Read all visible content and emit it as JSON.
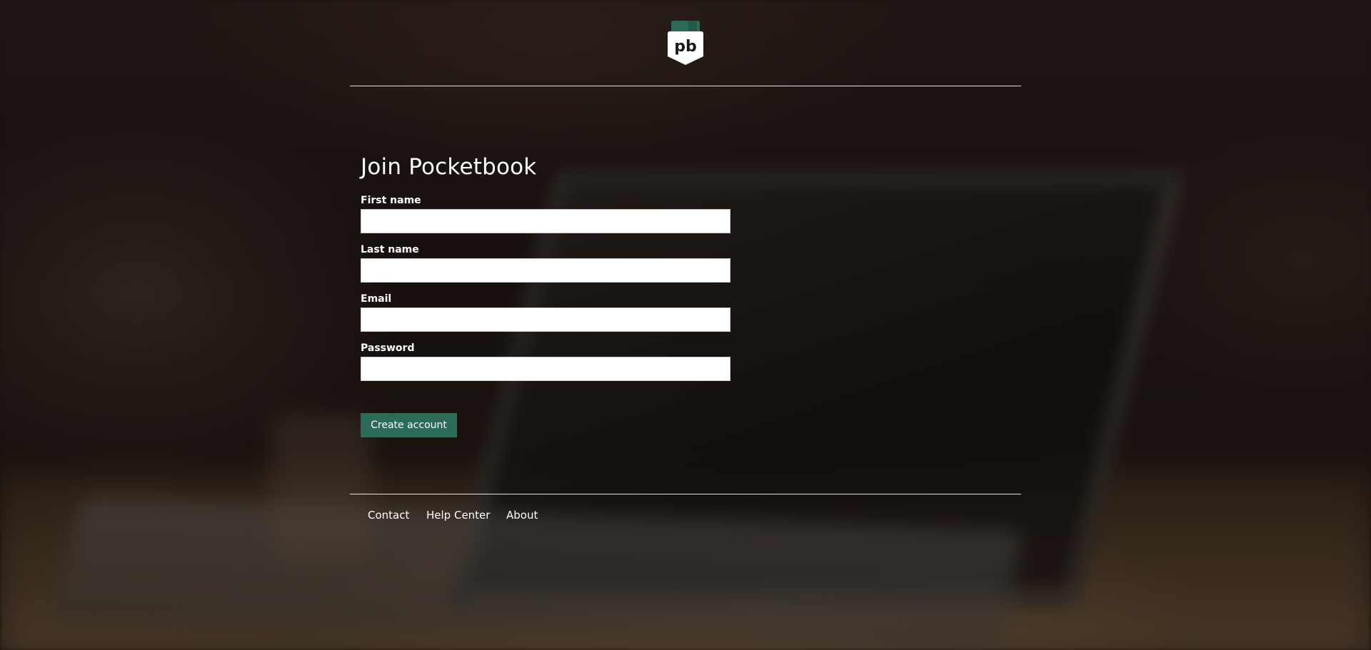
{
  "brand": {
    "logo_text": "pb",
    "logo_accent_color": "#2c6b5a"
  },
  "form": {
    "title": "Join Pocketbook",
    "fields": [
      {
        "label": "First name",
        "value": "",
        "placeholder": ""
      },
      {
        "label": "Last name",
        "value": "",
        "placeholder": ""
      },
      {
        "label": "Email",
        "value": "",
        "placeholder": ""
      },
      {
        "label": "Password",
        "value": "",
        "placeholder": ""
      }
    ],
    "submit_label": "Create account",
    "submit_color": "#2c6b5a"
  },
  "footer": {
    "links": [
      {
        "label": "Contact"
      },
      {
        "label": "Help Center"
      },
      {
        "label": "About"
      }
    ]
  }
}
